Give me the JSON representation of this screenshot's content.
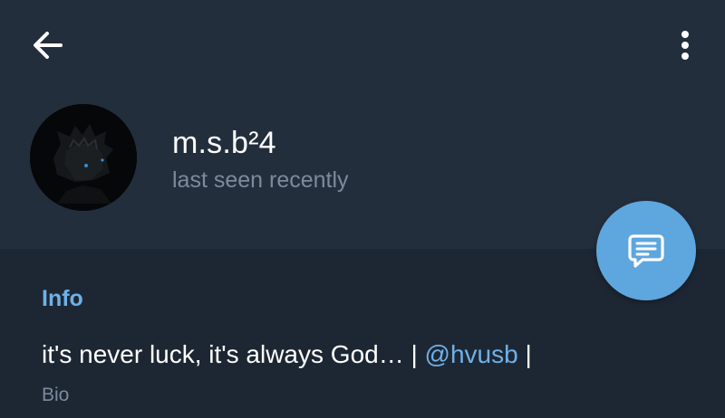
{
  "header": {
    "back_icon": "arrow-left-icon",
    "menu_icon": "more-vertical-icon",
    "name": "m.s.b²4",
    "status": "last seen recently",
    "avatar_icon": "avatar-image"
  },
  "fab": {
    "icon": "message-icon",
    "color": "#5ea6de"
  },
  "info": {
    "title": "Info",
    "bio_before": "it's never luck, it's always God… | ",
    "bio_link": "@hvusb",
    "bio_after": " |",
    "bio_label": "Bio"
  },
  "colors": {
    "header_bg": "#232e3c",
    "body_bg": "#1d2733",
    "accent": "#6fb0e8",
    "secondary_text": "#7b8b9c"
  }
}
